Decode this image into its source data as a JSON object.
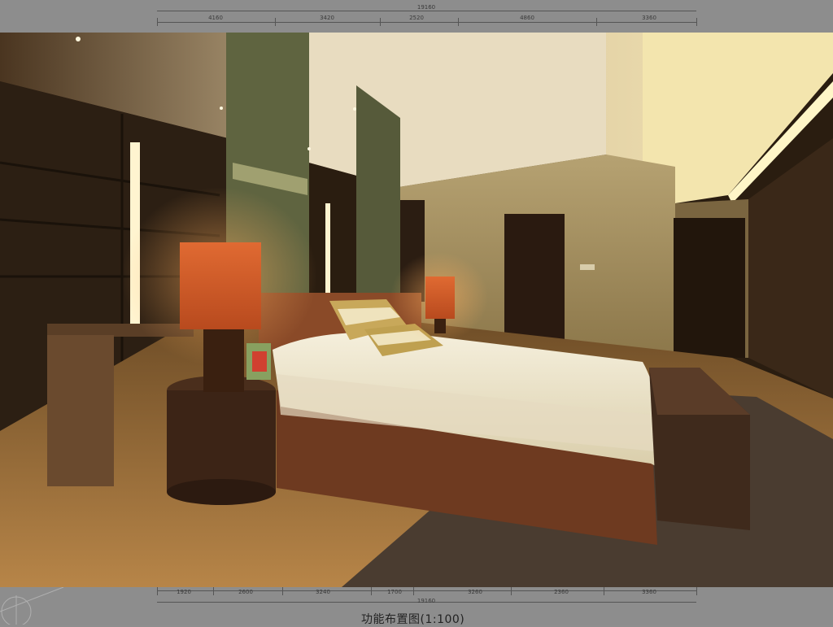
{
  "drawing": {
    "top_dimensions": {
      "total": "19160",
      "segments": [
        "4160",
        "3420",
        "2520",
        "4860",
        "3360"
      ]
    },
    "bottom_dimensions": {
      "total": "19160",
      "segments": [
        "1920",
        "2600",
        "3240",
        "1700",
        "3260",
        "2360",
        "3360"
      ]
    },
    "caption": "功能布置图(1:100)"
  },
  "photo": {
    "subject": "bedroom-interior"
  }
}
